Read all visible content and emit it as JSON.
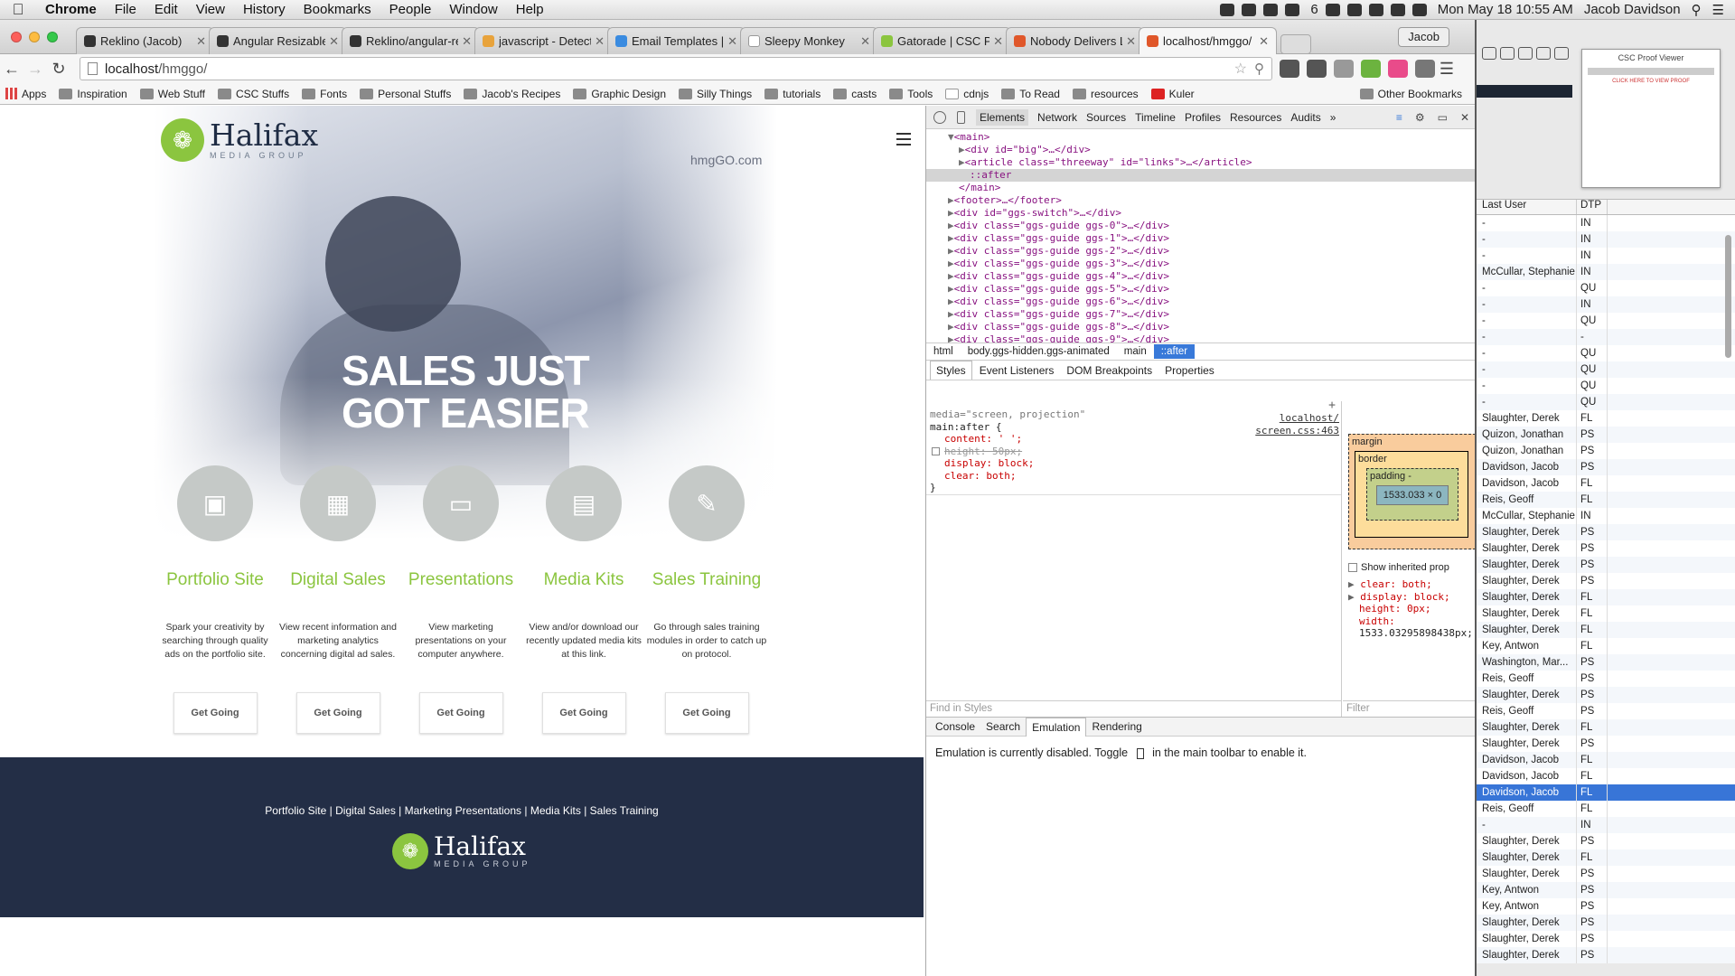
{
  "menubar": {
    "app": "Chrome",
    "items": [
      "File",
      "Edit",
      "View",
      "History",
      "Bookmarks",
      "People",
      "Window",
      "Help"
    ],
    "ai_count": "6",
    "clock": "Mon May 18  10:55 AM",
    "user": "Jacob Davidson"
  },
  "tabs": [
    {
      "title": "Reklino (Jacob)"
    },
    {
      "title": "Angular Resizable"
    },
    {
      "title": "Reklino/angular-re"
    },
    {
      "title": "javascript - Detect"
    },
    {
      "title": "Email Templates | K"
    },
    {
      "title": "Sleepy Monkey"
    },
    {
      "title": "Gatorade | CSC Port"
    },
    {
      "title": "Nobody Delivers Lik"
    },
    {
      "title": "localhost/hmggo/"
    }
  ],
  "profile": "Jacob",
  "url": {
    "host": "localhost",
    "path": "/hmggo/"
  },
  "bookmarks": [
    "Apps",
    "Inspiration",
    "Web Stuff",
    "CSC Stuffs",
    "Fonts",
    "Personal Stuffs",
    "Jacob's Recipes",
    "Graphic Design",
    "Silly Things",
    "tutorials",
    "casts",
    "Tools",
    "cdnjs",
    "To Read",
    "resources",
    "Kuler",
    "Other Bookmarks"
  ],
  "site": {
    "logo_name": "Halifax",
    "logo_sub": "MEDIA GROUP",
    "link": "hmgGO.com",
    "hero_line1": "SALES JUST",
    "hero_line2": "GOT EASIER",
    "services": [
      {
        "title": "Portfolio Site",
        "desc": "Spark your creativity by searching through quality ads on the portfolio site.",
        "button": "Get Going",
        "icon": "briefcase-icon"
      },
      {
        "title": "Digital Sales",
        "desc": "View recent information and marketing analytics concerning digital ad sales.",
        "button": "Get Going",
        "icon": "chart-icon"
      },
      {
        "title": "Presentations",
        "desc": "View marketing presentations on your computer anywhere.",
        "button": "Get Going",
        "icon": "laptop-icon"
      },
      {
        "title": "Media Kits",
        "desc": "View and/or download our recently updated media kits at this link.",
        "button": "Get Going",
        "icon": "book-icon"
      },
      {
        "title": "Sales Training",
        "desc": "Go through sales training modules in order to catch up on protocol.",
        "button": "Get Going",
        "icon": "edit-icon"
      }
    ],
    "footer_links": [
      "Portfolio Site",
      "Digital Sales",
      "Marketing Presentations",
      "Media Kits",
      "Sales Training"
    ]
  },
  "devtools": {
    "panels": [
      "Elements",
      "Network",
      "Sources",
      "Timeline",
      "Profiles",
      "Resources",
      "Audits"
    ],
    "dom": [
      "<main>",
      "<div id=\"big\">…</div>",
      "<article class=\"threeway\" id=\"links\">…</article>",
      "::after",
      "</main>",
      "<footer>…</footer>",
      "<div id=\"ggs-switch\">…</div>",
      "<div class=\"ggs-guide ggs-0\">…</div>",
      "<div class=\"ggs-guide ggs-1\">…</div>",
      "<div class=\"ggs-guide ggs-2\">…</div>",
      "<div class=\"ggs-guide ggs-3\">…</div>",
      "<div class=\"ggs-guide ggs-4\">…</div>",
      "<div class=\"ggs-guide ggs-5\">…</div>",
      "<div class=\"ggs-guide ggs-6\">…</div>",
      "<div class=\"ggs-guide ggs-7\">…</div>",
      "<div class=\"ggs-guide ggs-8\">…</div>",
      "<div class=\"ggs-guide ggs-9\">…</div>"
    ],
    "breadcrumbs": [
      "html",
      "body.ggs-hidden.ggs-animated",
      "main",
      "::after"
    ],
    "subtabs": [
      "Styles",
      "Event Listeners",
      "DOM Breakpoints",
      "Properties"
    ],
    "rule": {
      "media": "media=\"screen, projection\"",
      "selector": "main:after {",
      "src1": "localhost/",
      "src2": "screen.css:463",
      "p1": "content: ' ';",
      "p2": "height: 50px;",
      "p3": "display: block;",
      "p4": "clear: both;",
      "close": "}"
    },
    "box": {
      "margin": "margin",
      "border": "border",
      "padding": "padding -",
      "content": "1533.033 × 0",
      "dash": "-"
    },
    "show_inherited": "Show inherited prop",
    "computed": [
      "clear: both;",
      "display: block;",
      "height: 0px;",
      "width:",
      "1533.03295898438px;"
    ],
    "find": "Find in Styles",
    "filter": "Filter",
    "drawer_tabs": [
      "Console",
      "Search",
      "Emulation",
      "Rendering"
    ],
    "emulation_msg_a": "Emulation is currently disabled. Toggle",
    "emulation_msg_b": "in the main toolbar to enable it."
  },
  "right_panel": {
    "proof_title": "CSC Proof Viewer",
    "proof_link": "CLICK HERE TO VIEW PROOF",
    "col1": "Last User",
    "col2": "DTP",
    "rows": [
      [
        "-",
        "IN"
      ],
      [
        "-",
        "IN"
      ],
      [
        "-",
        "IN"
      ],
      [
        "McCullar, Stephanie",
        "IN"
      ],
      [
        "-",
        "QU"
      ],
      [
        "-",
        "IN"
      ],
      [
        "-",
        "QU"
      ],
      [
        "-",
        "-"
      ],
      [
        "-",
        "QU"
      ],
      [
        "-",
        "QU"
      ],
      [
        "-",
        "QU"
      ],
      [
        "-",
        "QU"
      ],
      [
        "Slaughter, Derek",
        "FL"
      ],
      [
        "Quizon, Jonathan",
        "PS"
      ],
      [
        "Quizon, Jonathan",
        "PS"
      ],
      [
        "Davidson, Jacob",
        "PS"
      ],
      [
        "Davidson, Jacob",
        "FL"
      ],
      [
        "Reis, Geoff",
        "FL"
      ],
      [
        "McCullar, Stephanie",
        "IN"
      ],
      [
        "Slaughter, Derek",
        "PS"
      ],
      [
        "Slaughter, Derek",
        "PS"
      ],
      [
        "Slaughter, Derek",
        "PS"
      ],
      [
        "Slaughter, Derek",
        "PS"
      ],
      [
        "Slaughter, Derek",
        "FL"
      ],
      [
        "Slaughter, Derek",
        "FL"
      ],
      [
        "Slaughter, Derek",
        "FL"
      ],
      [
        "Key, Antwon",
        "FL"
      ],
      [
        "Washington, Mar...",
        "PS"
      ],
      [
        "Reis, Geoff",
        "PS"
      ],
      [
        "Slaughter, Derek",
        "PS"
      ],
      [
        "Reis, Geoff",
        "PS"
      ],
      [
        "Slaughter, Derek",
        "FL"
      ],
      [
        "Slaughter, Derek",
        "PS"
      ],
      [
        "Davidson, Jacob",
        "FL"
      ],
      [
        "Davidson, Jacob",
        "FL"
      ],
      [
        "Davidson, Jacob",
        "FL"
      ],
      [
        "Reis, Geoff",
        "FL"
      ],
      [
        "-",
        "IN"
      ],
      [
        "Slaughter, Derek",
        "PS"
      ],
      [
        "Slaughter, Derek",
        "FL"
      ],
      [
        "Slaughter, Derek",
        "PS"
      ],
      [
        "Key, Antwon",
        "PS"
      ],
      [
        "Key, Antwon",
        "PS"
      ],
      [
        "Slaughter, Derek",
        "PS"
      ],
      [
        "Slaughter, Derek",
        "PS"
      ],
      [
        "Slaughter, Derek",
        "PS"
      ]
    ],
    "selected_row": 35
  }
}
